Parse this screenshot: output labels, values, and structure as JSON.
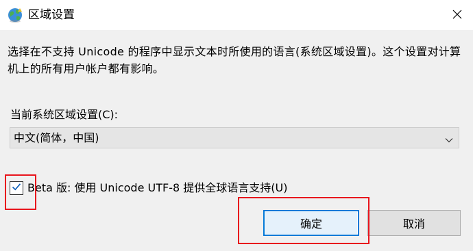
{
  "window": {
    "title": "区域设置",
    "icon": "globe-icon",
    "close_icon": "close-icon"
  },
  "description": "选择在不支持 Unicode 的程序中显示文本时所使用的语言(系统区域设置)。这个设置对计算机上的所有用户帐户都有影响。",
  "locale": {
    "label": "当前系统区域设置(C):",
    "selected": "中文(简体，中国)",
    "chevron_icon": "chevron-down-icon"
  },
  "beta": {
    "checked": true,
    "label": "Beta 版: 使用 Unicode UTF-8 提供全球语言支持(U)"
  },
  "buttons": {
    "ok": "确定",
    "cancel": "取消"
  },
  "colors": {
    "highlight": "#e8141c",
    "accent": "#0078d7",
    "background": "#f0f0f0"
  }
}
